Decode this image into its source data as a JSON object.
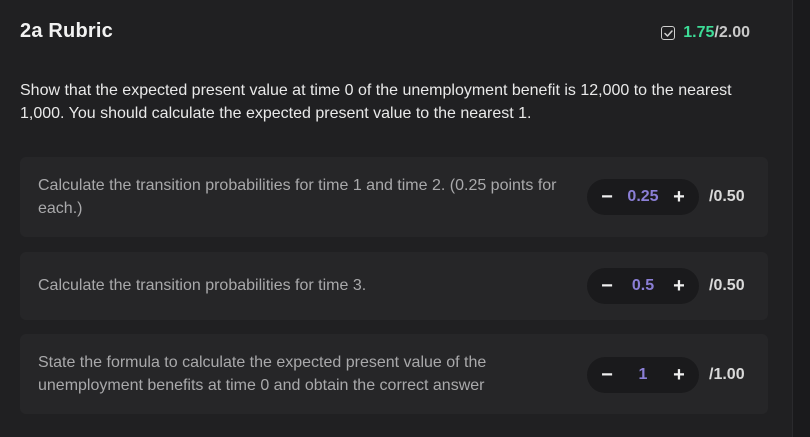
{
  "header": {
    "title": "2a Rubric",
    "score_awarded": "1.75",
    "score_total": "/2.00",
    "score_icon": "check-square-icon"
  },
  "question": {
    "text": "Show that the expected present value at time 0 of the unemployment benefit is 12,000 to the nearest 1,000. You should calculate the expected present value to the nearest 1."
  },
  "criteria": [
    {
      "description": "Calculate the transition probabilities for time 1 and time 2. (0.25 points for each.)",
      "value": "0.25",
      "max": "/0.50",
      "minus_label": "−",
      "plus_label": "+"
    },
    {
      "description": "Calculate the transition probabilities for time 3.",
      "value": "0.5",
      "max": "/0.50",
      "minus_label": "−",
      "plus_label": "+"
    },
    {
      "description": "State the formula to calculate the expected present value of the unemployment benefits at time 0 and obtain the correct answer",
      "value": "1",
      "max": "/1.00",
      "minus_label": "−",
      "plus_label": "+"
    }
  ],
  "colors": {
    "awarded": "#3ddc97",
    "stepper_value": "#8b7fd6"
  }
}
